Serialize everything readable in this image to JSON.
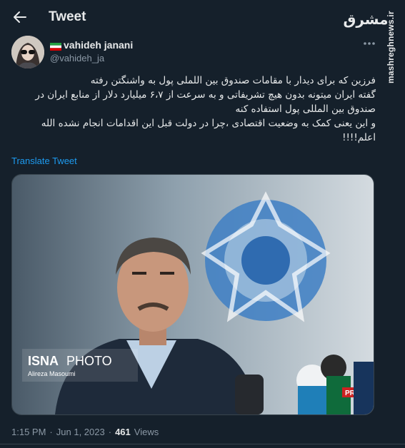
{
  "header": {
    "title": "Tweet",
    "watermark_logo": "مشرق",
    "watermark_site": "mashreghnews.ir"
  },
  "author": {
    "display_name": "vahideh janani",
    "handle": "@vahideh_ja"
  },
  "tweet": {
    "text": "فرزین که برای دیدار با مقامات صندوق بین اللملی پول به واشنگتن رفته\nگفته ایران میتونه بدون هیچ تشریفاتی و به سرعت از ۶،۷ میلیارد دلار از منابع ایران  در صندوق بین المللی پول استفاده کنه\nو این یعنی کمک به وضعیت اقتصادی ،چرا در دولت قبل این اقدامات انجام نشده الله اعلم!!!!",
    "translate_label": "Translate Tweet"
  },
  "media": {
    "photo_credit_brand": "ISNA",
    "photo_credit_word": "PHOTO",
    "photographer": "Alireza Masoumi",
    "mic_label": "PRESS"
  },
  "meta": {
    "time": "1:15 PM",
    "separator1": "·",
    "date": "Jun 1, 2023",
    "separator2": "·",
    "views_count": "461",
    "views_label": "Views"
  }
}
